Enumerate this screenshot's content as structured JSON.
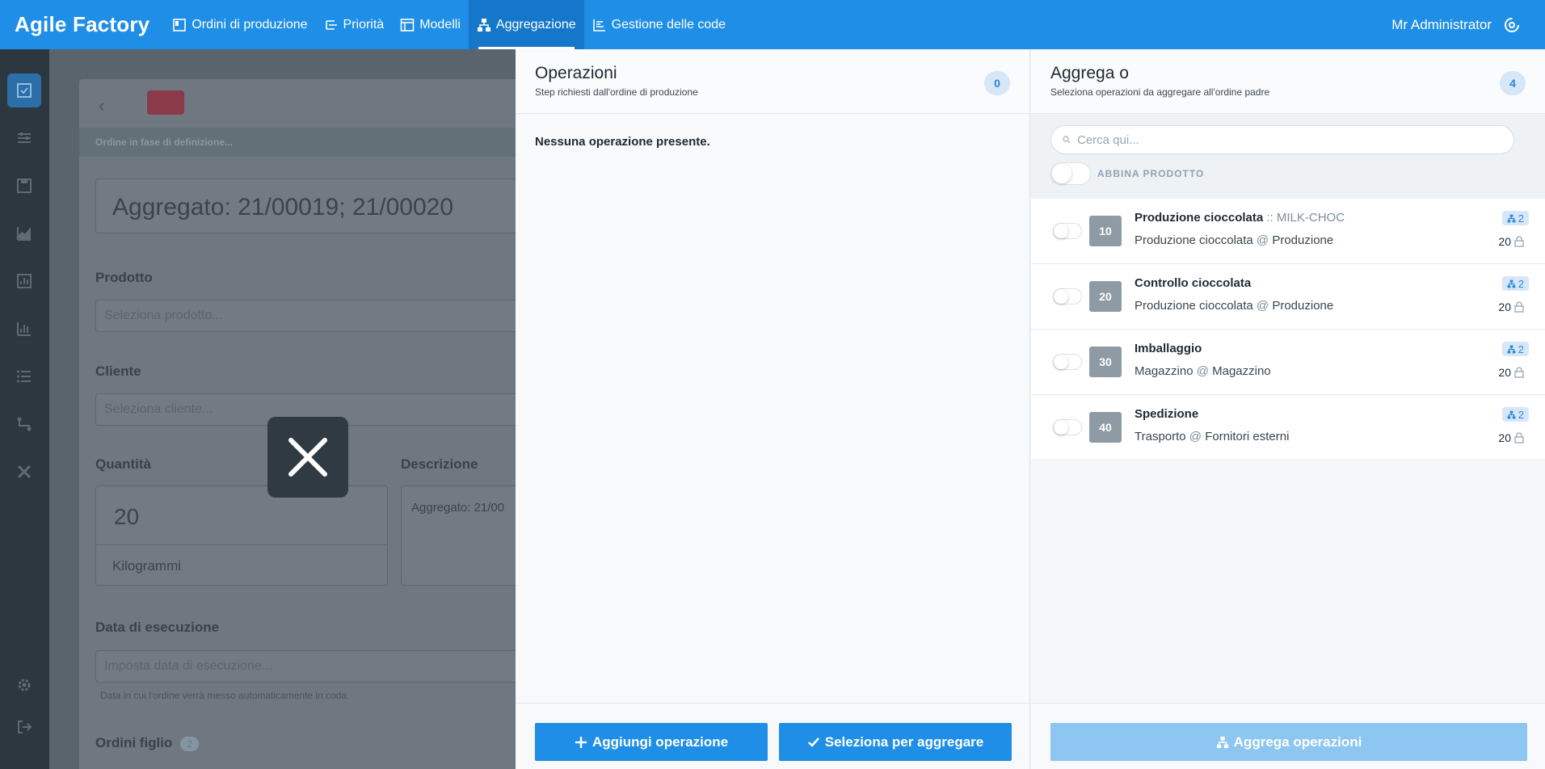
{
  "app": {
    "brand": "Agile Factory",
    "user": "Mr Administrator"
  },
  "nav": [
    {
      "label": "Ordini di produzione",
      "icon": "orders-icon"
    },
    {
      "label": "Priorità",
      "icon": "priority-icon"
    },
    {
      "label": "Modelli",
      "icon": "templates-icon"
    },
    {
      "label": "Aggregazione",
      "icon": "aggregation-icon",
      "active": true
    },
    {
      "label": "Gestione delle code",
      "icon": "queue-icon"
    }
  ],
  "background_form": {
    "status": "Ordine in fase di definizione...",
    "title": "Aggregato: 21/00019; 21/00020",
    "product_label": "Prodotto",
    "product_placeholder": "Seleziona prodotto...",
    "customer_label": "Cliente",
    "customer_placeholder": "Seleziona cliente...",
    "quantity_label": "Quantità",
    "quantity_value": "20",
    "unit_value": "Kilogrammi",
    "description_label": "Descrizione",
    "description_value": "Aggregato: 21/00",
    "date_label": "Data di esecuzione",
    "date_placeholder": "Imposta data di esecuzione...",
    "date_hint": "Data in cui l'ordine verrà messo automaticamente in coda.",
    "children_label": "Ordini figlio",
    "children_count": "2"
  },
  "operations_panel": {
    "title": "Operazioni",
    "subtitle": "Step richiesti dall'ordine di produzione",
    "count": "0",
    "empty_text": "Nessuna operazione presente.",
    "add_button": "Aggiungi operazione",
    "select_button": "Seleziona per aggregare"
  },
  "aggregate_panel": {
    "title": "Aggrega o",
    "subtitle": "Seleziona operazioni da aggregare all'ordine padre",
    "count": "4",
    "search_placeholder": "Cerca qui...",
    "match_product_label": "ABBINA PRODOTTO",
    "aggregate_button": "Aggrega operazioni",
    "operations": [
      {
        "code": "10",
        "name": "Produzione cioccolata",
        "sku_sep": " :: ",
        "sku": "MILK-CHOC",
        "location": "Produzione cioccolata",
        "at": " @ ",
        "site": "Produzione",
        "tag": "2",
        "qty": "20"
      },
      {
        "code": "20",
        "name": "Controllo cioccolata",
        "sku_sep": "",
        "sku": "",
        "location": "Produzione cioccolata",
        "at": " @ ",
        "site": "Produzione",
        "tag": "2",
        "qty": "20"
      },
      {
        "code": "30",
        "name": "Imballaggio",
        "sku_sep": "",
        "sku": "",
        "location": "Magazzino",
        "at": " @ ",
        "site": "Magazzino",
        "tag": "2",
        "qty": "20"
      },
      {
        "code": "40",
        "name": "Spedizione",
        "sku_sep": "",
        "sku": "",
        "location": "Trasporto",
        "at": " @ ",
        "site": "Fornitori esterni",
        "tag": "2",
        "qty": "20"
      }
    ]
  },
  "colors": {
    "primary": "#1f8ee6",
    "primary_dark": "#1577c9",
    "sidebar": "#2d3740",
    "code_badge": "#8e9ba5",
    "disabled_button": "#8cc6f1"
  }
}
